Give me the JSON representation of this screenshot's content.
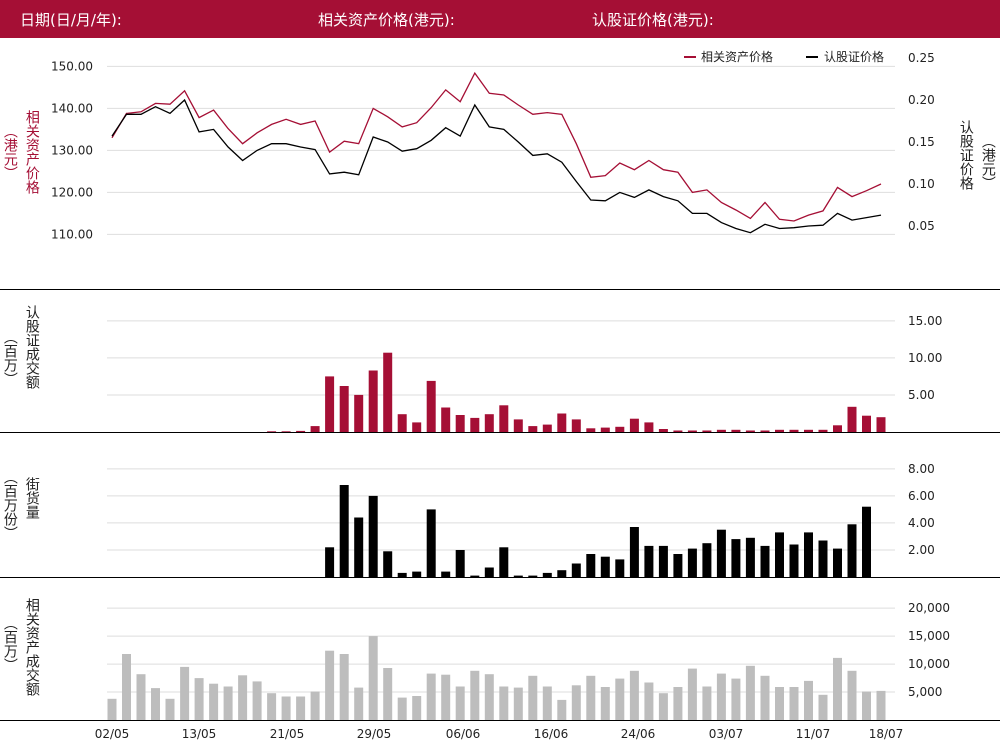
{
  "header": {
    "date_label": "日期(日/月/年):",
    "underlying_label": "相关资产价格(港元):",
    "warrant_label": "认股证价格(港元):"
  },
  "axis_labels": {
    "p1_left": "相关资产价格",
    "p1_left_unit": "（港元）",
    "p1_right": "认股证价格",
    "p1_right_unit": "（港元）",
    "p2": "认股证成交额",
    "p2_unit": "（百万）",
    "p3": "街货量",
    "p3_unit": "（百万份）",
    "p4": "相关资产成交额",
    "p4_unit": "（百万）"
  },
  "legend": {
    "underlying": "相关资产价格",
    "warrant": "认股证价格"
  },
  "colors": {
    "brand": "#a50f35",
    "warrant_line": "#000000",
    "turnover_bar": "#a50f35",
    "outstanding_bar": "#000000",
    "underlying_turnover_bar": "#bdbdbd"
  },
  "chart_data": [
    {
      "type": "line",
      "x_ticks": [
        "02/05",
        "13/05",
        "21/05",
        "29/05",
        "06/06",
        "16/06",
        "24/06",
        "03/07",
        "11/07",
        "18/07"
      ],
      "left_ylim": [
        102,
        152
      ],
      "left_ticks": [
        "110.00",
        "120.00",
        "130.00",
        "140.00",
        "150.00"
      ],
      "right_ylim": [
        0.0,
        0.25
      ],
      "right_ticks": [
        "0.05",
        "0.10",
        "0.15",
        "0.20",
        "0.25"
      ],
      "series": [
        {
          "name": "相关资产价格",
          "axis": "left",
          "values": [
            133.0,
            138.8,
            139.2,
            141.2,
            141.0,
            144.2,
            137.8,
            139.6,
            135.2,
            131.6,
            134.2,
            136.2,
            137.4,
            136.2,
            137.0,
            129.6,
            132.2,
            131.6,
            140.0,
            138.0,
            135.6,
            136.6,
            140.2,
            144.4,
            141.6,
            148.4,
            143.6,
            143.2,
            140.8,
            138.6,
            139.0,
            138.6,
            131.6,
            123.6,
            124.0,
            127.0,
            125.4,
            127.6,
            125.4,
            124.8,
            120.0,
            120.6,
            117.6,
            115.8,
            113.8,
            117.6,
            113.6,
            113.2,
            114.6,
            115.6,
            121.2,
            119.0,
            120.4,
            122.0
          ]
        },
        {
          "name": "认股证价格",
          "axis": "right",
          "values": [
            0.157,
            0.183,
            0.183,
            0.192,
            0.184,
            0.2,
            0.162,
            0.165,
            0.144,
            0.128,
            0.14,
            0.148,
            0.148,
            0.144,
            0.141,
            0.112,
            0.114,
            0.111,
            0.156,
            0.15,
            0.139,
            0.142,
            0.152,
            0.167,
            0.157,
            0.194,
            0.168,
            0.165,
            0.15,
            0.134,
            0.136,
            0.126,
            0.103,
            0.081,
            0.08,
            0.09,
            0.084,
            0.093,
            0.085,
            0.08,
            0.065,
            0.065,
            0.054,
            0.047,
            0.042,
            0.052,
            0.047,
            0.048,
            0.05,
            0.051,
            0.065,
            0.057,
            0.06,
            0.063
          ]
        }
      ]
    },
    {
      "type": "bar",
      "name": "认股证成交额",
      "ylim": [
        0,
        17
      ],
      "y_ticks": [
        "5.00",
        "10.00",
        "15.00"
      ],
      "values": [
        0,
        0,
        0,
        0,
        0,
        0,
        0,
        0,
        0,
        0,
        0,
        0.1,
        0.1,
        0.15,
        0.8,
        7.5,
        6.2,
        5.0,
        8.3,
        10.7,
        2.4,
        1.3,
        6.9,
        3.3,
        2.3,
        1.9,
        2.4,
        3.6,
        1.7,
        0.8,
        1.0,
        2.5,
        1.7,
        0.5,
        0.6,
        0.7,
        1.8,
        1.3,
        0.4,
        0.2,
        0.2,
        0.2,
        0.3,
        0.3,
        0.2,
        0.2,
        0.3,
        0.3,
        0.3,
        0.3,
        0.9,
        3.4,
        2.2,
        2.0
      ]
    },
    {
      "type": "bar",
      "name": "街货量",
      "ylim": [
        0,
        8.8
      ],
      "y_ticks": [
        "2.00",
        "4.00",
        "6.00",
        "8.00"
      ],
      "values": [
        0,
        0,
        0,
        0,
        0,
        0,
        0,
        0,
        0,
        0,
        0,
        0,
        0,
        0,
        0,
        2.2,
        6.8,
        4.4,
        6.0,
        1.9,
        0.3,
        0.4,
        5.0,
        0.4,
        2.0,
        0.1,
        0.7,
        2.2,
        0.1,
        0.1,
        0.3,
        0.5,
        1.0,
        1.7,
        1.5,
        1.3,
        3.7,
        2.3,
        2.3,
        1.7,
        2.1,
        2.5,
        3.5,
        2.8,
        2.9,
        2.3,
        3.3,
        2.4,
        3.3,
        2.7,
        2.1,
        3.9,
        5.2,
        0
      ]
    },
    {
      "type": "bar",
      "name": "相关资产成交额",
      "ylim": [
        0,
        22000
      ],
      "y_ticks": [
        "5,000",
        "10,000",
        "15,000",
        "20,000"
      ],
      "values": [
        3800,
        11800,
        8200,
        5700,
        3800,
        9500,
        7500,
        6500,
        6000,
        8000,
        6900,
        4800,
        4200,
        4200,
        5100,
        12400,
        11800,
        5800,
        15000,
        9300,
        4000,
        4300,
        8300,
        8100,
        6000,
        8800,
        8200,
        6000,
        5800,
        7900,
        6000,
        3600,
        6200,
        7900,
        5900,
        7400,
        8800,
        6700,
        4800,
        5900,
        9200,
        6000,
        8300,
        7400,
        9700,
        7900,
        5900,
        5900,
        7000,
        4500,
        11100,
        8800,
        5100,
        5200
      ]
    }
  ]
}
